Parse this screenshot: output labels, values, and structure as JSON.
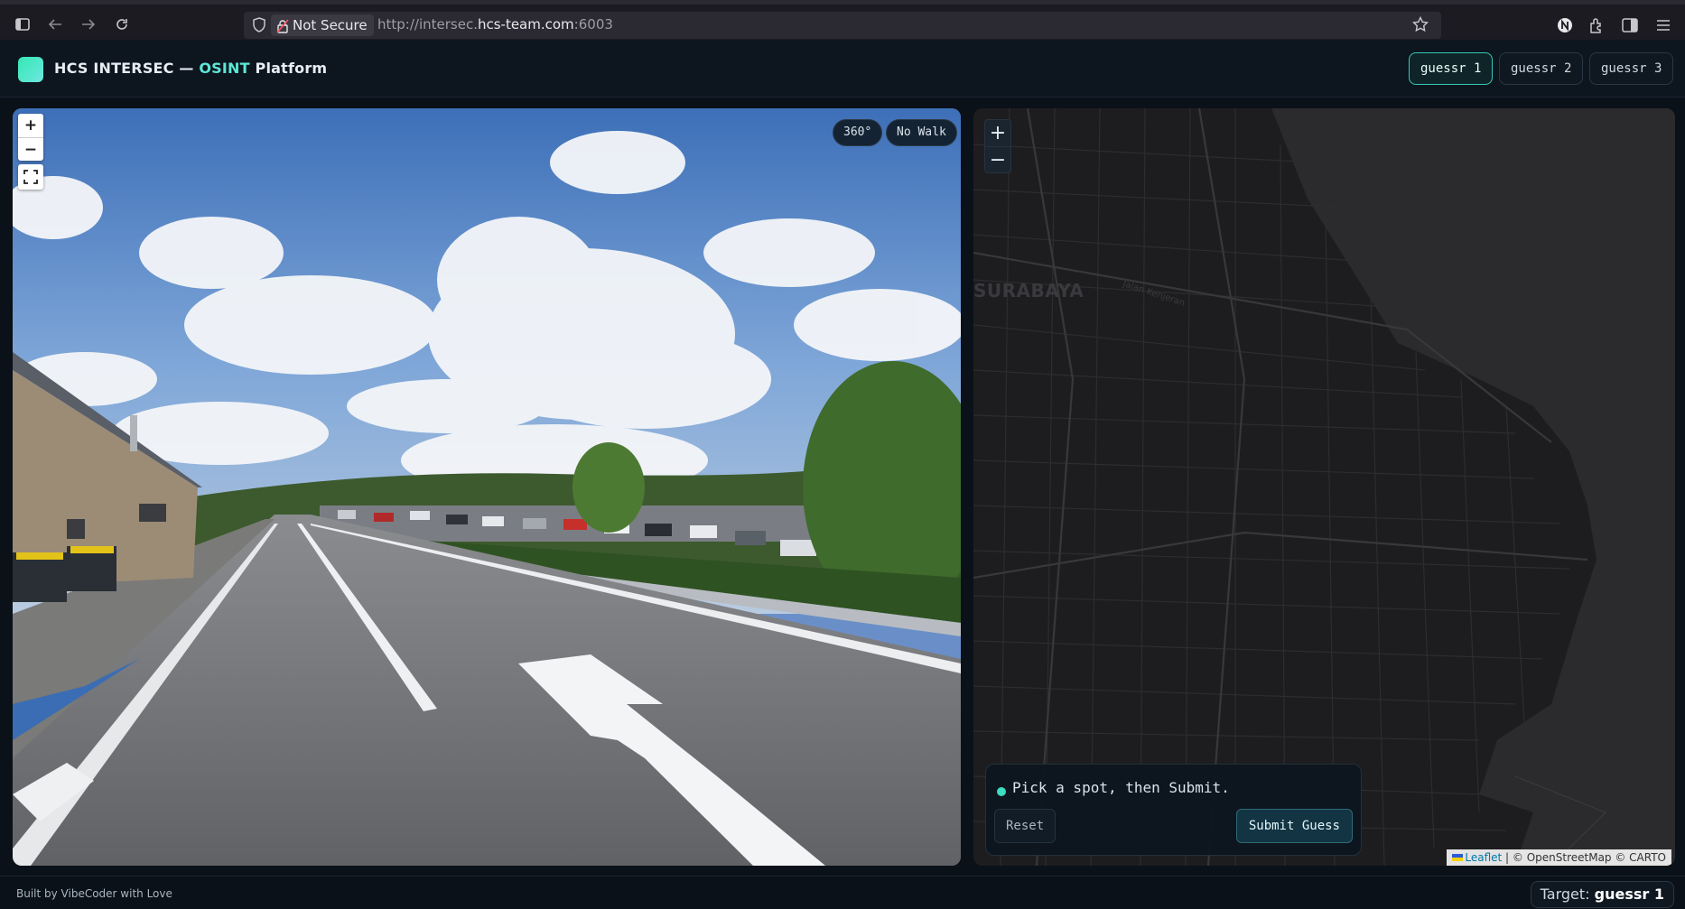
{
  "browser": {
    "not_secure_label": "Not Secure",
    "url_prefix": "http://intersec.",
    "url_host": "hcs-team.com",
    "url_suffix": ":6003"
  },
  "header": {
    "title_prefix": "HCS INTERSEC — ",
    "title_accent": "OSINT",
    "title_suffix": " Platform",
    "tabs": [
      {
        "label": "guessr 1",
        "active": true
      },
      {
        "label": "guessr 2",
        "active": false
      },
      {
        "label": "guessr 3",
        "active": false
      }
    ]
  },
  "streetview": {
    "zoom_in": "+",
    "zoom_out": "−",
    "badge_360": "360°",
    "badge_walk": "No Walk"
  },
  "map": {
    "zoom_in": "+",
    "zoom_out": "−",
    "city_label": "SURABAYA",
    "road_label": "Jalan Kenjeran",
    "guess_prompt": "Pick a spot, then Submit.",
    "reset_label": "Reset",
    "submit_label": "Submit Guess",
    "attribution_leaflet": "Leaflet",
    "attribution_rest": " | © OpenStreetMap © CARTO"
  },
  "footer": {
    "credit": "Built by VibeCoder with Love",
    "target_label": "Target: ",
    "target_value": "guessr 1"
  },
  "colors": {
    "accent": "#5ee6d6",
    "background": "#0b1118",
    "map_land": "#1d1d1f"
  }
}
